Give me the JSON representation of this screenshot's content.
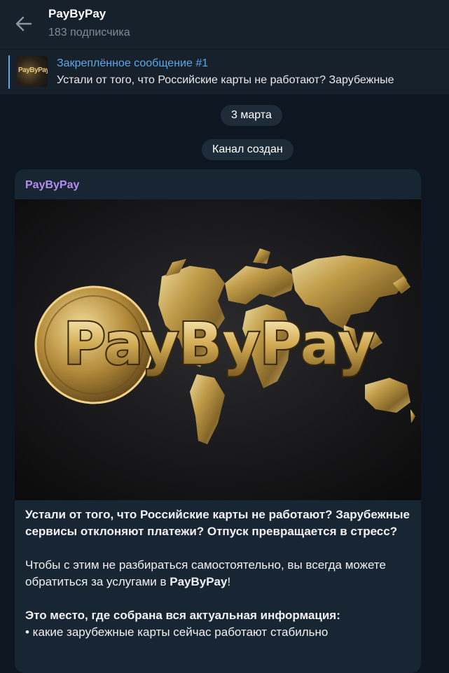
{
  "header": {
    "channel_name": "PayByPay",
    "subscribers": "183 подписчика",
    "back_icon": "arrow-left-icon"
  },
  "pinned": {
    "label": "Закреплённое сообщение #1",
    "preview": "Устали от того, что Российские карты не работают? Зарубежные",
    "thumb_text": "PayByPay"
  },
  "service": {
    "date": "3 марта",
    "created": "Канал создан"
  },
  "message": {
    "author": "PayByPay",
    "image_logo_text": "PayByPay",
    "para1": "Устали от того, что Российские карты не работают? Зарубежные сервисы отклоняют платежи? Отпуск превращается в стресс?",
    "para2_start": "Чтобы с этим не разбираться самостоятельно, вы всегда можете обратиться за услугами в ",
    "para2_brand": "PayByPay",
    "para2_end": "!",
    "para3_heading": "Это место, где собрана вся актуальная информация:",
    "bullet1": "• какие зарубежные карты сейчас работают стабильно"
  },
  "colors": {
    "background": "#0e1621",
    "header": "#17212b",
    "bubble": "#182533",
    "accent_link": "#5ea7e8",
    "author": "#b38cf1",
    "gold": "#d4af37"
  }
}
